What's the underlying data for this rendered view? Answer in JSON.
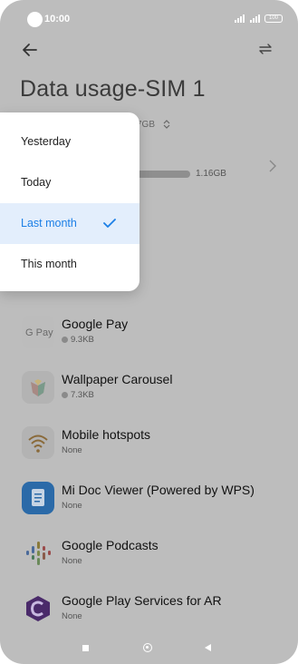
{
  "status_bar": {
    "time": "10:00",
    "battery": "100"
  },
  "page": {
    "title": "Data usage-SIM 1"
  },
  "summary": {
    "total_fragment": "7GB",
    "chevron": "⌃⌄",
    "bar_value": "1.16GB"
  },
  "menu": {
    "items": [
      {
        "label": "Yesterday",
        "selected": false
      },
      {
        "label": "Today",
        "selected": false
      },
      {
        "label": "Last month",
        "selected": true
      },
      {
        "label": "This month",
        "selected": false
      }
    ]
  },
  "apps": [
    {
      "name": "Google Pay",
      "usage": "9.3KB",
      "icon": "google-pay-icon"
    },
    {
      "name": "Wallpaper Carousel",
      "usage": "7.3KB",
      "icon": "wallpaper-carousel-icon"
    },
    {
      "name": "Mobile hotspots",
      "usage": "None",
      "icon": "wifi-hotspot-icon"
    },
    {
      "name": "Mi Doc Viewer (Powered by WPS)",
      "usage": "None",
      "icon": "document-icon"
    },
    {
      "name": "Google Podcasts",
      "usage": "None",
      "icon": "podcasts-icon"
    },
    {
      "name": "Google Play Services for AR",
      "usage": "None",
      "icon": "ar-core-icon"
    }
  ],
  "colors": {
    "accent": "#1c7fe6",
    "scrim_bg": "#bdbdbd"
  }
}
